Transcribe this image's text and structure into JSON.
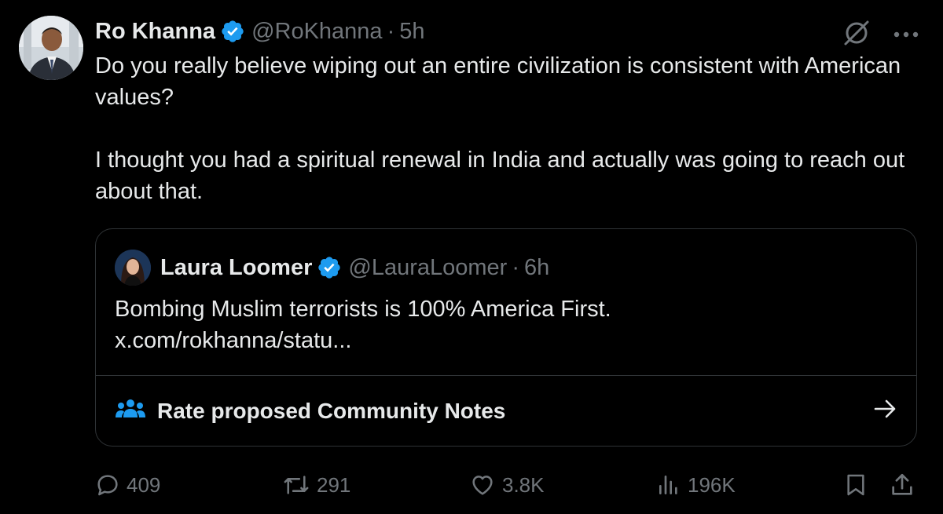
{
  "tweet": {
    "author_name": "Ro Khanna",
    "author_handle": "@RoKhanna",
    "separator": "·",
    "time": "5h",
    "paragraphs": [
      "Do you really believe wiping out an entire civilization is consistent with American values?",
      "I thought you had a spiritual renewal in India and actually was going to reach out about that."
    ]
  },
  "quote": {
    "author_name": "Laura Loomer",
    "author_handle": "@LauraLoomer",
    "separator": "·",
    "time": "6h",
    "text_line1": "Bombing Muslim terrorists is 100% America First.",
    "link": "x.com/rokhanna/statu..."
  },
  "community_notes": {
    "label": "Rate proposed Community Notes"
  },
  "actions": {
    "replies": "409",
    "reposts": "291",
    "likes": "3.8K",
    "views": "196K"
  },
  "icons": {
    "verified": "verified-badge-icon",
    "grok": "grok-icon",
    "more": "more-icon",
    "notes": "community-notes-icon",
    "arrow": "arrow-right-icon",
    "reply": "reply-icon",
    "repost": "repost-icon",
    "like": "like-icon",
    "views": "views-icon",
    "bookmark": "bookmark-icon",
    "share": "share-icon"
  },
  "colors": {
    "background": "#000000",
    "text": "#e7e9ea",
    "secondary": "#71767b",
    "verified": "#1d9bf0",
    "border": "#2f3336"
  }
}
